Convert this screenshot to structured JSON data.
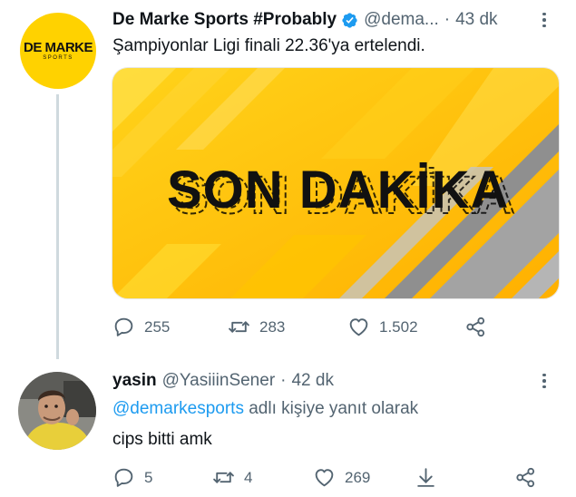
{
  "colors": {
    "accent": "#1d9bf0",
    "muted": "#536471",
    "logo_bg": "#ffd200",
    "banner_yellow": "#ffc400"
  },
  "tweet1": {
    "avatar": {
      "logo_main": "DE MARKE",
      "logo_sub": "SPORTS"
    },
    "author_name": "De Marke Sports #Probably",
    "handle": "@dema...",
    "separator": "·",
    "time": "43 dk",
    "text": "Şampiyonlar Ligi finali 22.36'ya ertelendi.",
    "media": {
      "banner_text": "SON DAKİKA"
    },
    "actions": {
      "replies": "255",
      "retweets": "283",
      "likes": "1.502"
    }
  },
  "tweet2": {
    "author_name": "yasin",
    "handle": "@YasiiinSener",
    "separator": "·",
    "time": "42 dk",
    "reply_mention": "@demarkesports",
    "reply_suffix": " adlı kişiye yanıt olarak",
    "text": "cips bitti amk",
    "actions": {
      "replies": "5",
      "retweets": "4",
      "likes": "269"
    }
  },
  "icons": {
    "verified": "verified-badge-icon",
    "more": "more-dots-icon",
    "reply": "reply-bubble-icon",
    "retweet": "retweet-icon",
    "like": "heart-icon",
    "share": "share-icon",
    "download": "download-arrow-icon"
  }
}
